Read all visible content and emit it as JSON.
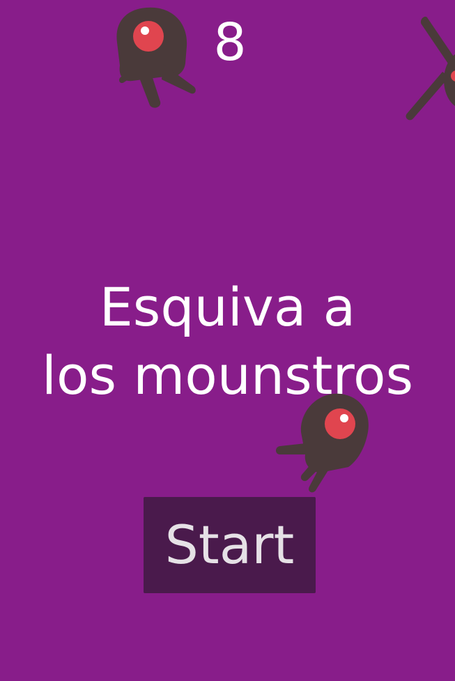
{
  "game": {
    "score": "8",
    "title_line1": "Esquiva a",
    "title_line2": "los mounstros",
    "start_label": "Start"
  },
  "colors": {
    "background": "#881d8a",
    "button_bg": "#4a1a4c",
    "monster_body": "#4a3a3a",
    "monster_eye": "#e0454f",
    "text": "#ffffff"
  },
  "icons": [
    "monster-icon",
    "monster-icon",
    "monster-icon"
  ]
}
